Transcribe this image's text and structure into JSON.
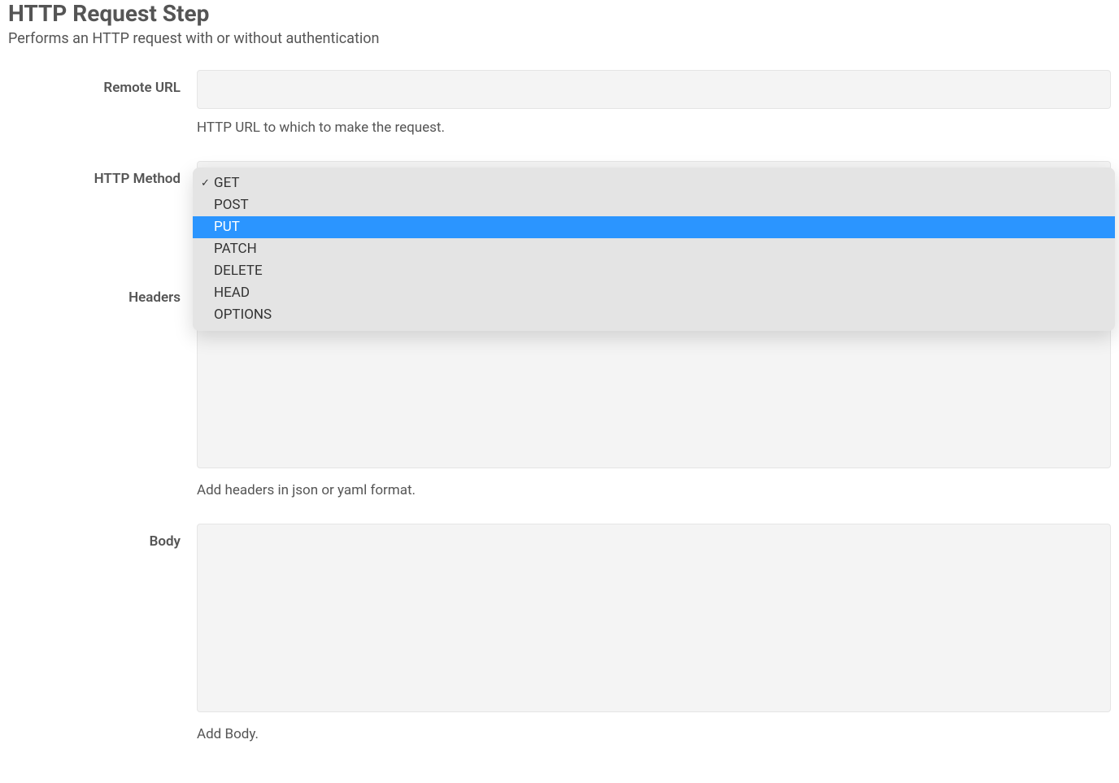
{
  "title": "HTTP Request Step",
  "subtitle": "Performs an HTTP request with or without authentication",
  "fields": {
    "remote_url": {
      "label": "Remote URL",
      "value": "",
      "help": "HTTP URL to which to make the request."
    },
    "http_method": {
      "label": "HTTP Method",
      "selected": "GET",
      "highlighted": "PUT",
      "options": [
        "GET",
        "POST",
        "PUT",
        "PATCH",
        "DELETE",
        "HEAD",
        "OPTIONS"
      ]
    },
    "headers": {
      "label": "Headers",
      "value": "",
      "help": "Add headers in json or yaml format."
    },
    "body": {
      "label": "Body",
      "value": "",
      "help": "Add Body."
    }
  }
}
